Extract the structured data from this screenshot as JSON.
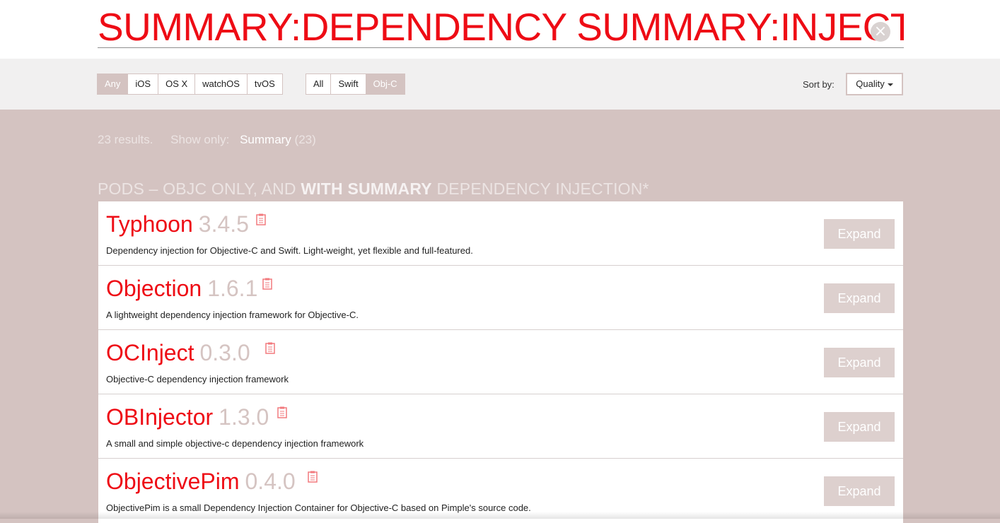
{
  "search": {
    "query": "SUMMARY:DEPENDENCY SUMMARY:INJECTION"
  },
  "filters": {
    "platforms": [
      "Any",
      "iOS",
      "OS X",
      "watchOS",
      "tvOS"
    ],
    "platform_selected": "Any",
    "languages": [
      "All",
      "Swift",
      "Obj-C"
    ],
    "language_selected": "Obj-C"
  },
  "sort": {
    "label": "Sort by:",
    "value": "Quality"
  },
  "summary": {
    "count_text": "23 results.",
    "show_only": "Show only:",
    "tag": "Summary",
    "tag_count": "(23)"
  },
  "section": {
    "prefix": "PODS – OBJC ONLY, AND",
    "bold": "WITH SUMMARY",
    "suffix": "DEPENDENCY INJECTION*"
  },
  "pods": [
    {
      "name": "Typhoon",
      "version": "3.4.5",
      "description": "Dependency injection for Objective-C and Swift. Light-weight, yet flexible and full-featured.",
      "action": "Expand"
    },
    {
      "name": "Objection",
      "version": "1.6.1",
      "description": "A lightweight dependency injection framework for Objective-C.",
      "action": "Expand"
    },
    {
      "name": "OCInject",
      "version": "0.3.0",
      "description": "Objective-C dependency injection framework",
      "action": "Expand"
    },
    {
      "name": "OBInjector",
      "version": "1.3.0",
      "description": "A small and simple objective-c dependency injection framework",
      "action": "Expand"
    },
    {
      "name": "ObjectivePim",
      "version": "0.4.0",
      "description": "ObjectivePim is a small Dependency Injection Container for Objective-C based on Pimple's source code.",
      "action": "Expand"
    }
  ],
  "colors": {
    "accent": "#ee0c15",
    "panel": "#d4c3c1",
    "version": "#d5c4c2",
    "expand_button": "#ddd0ce"
  },
  "icons": {
    "clear": "close-circle-icon",
    "clipboard": "clipboard-icon",
    "sort": "caret-down-icon"
  }
}
